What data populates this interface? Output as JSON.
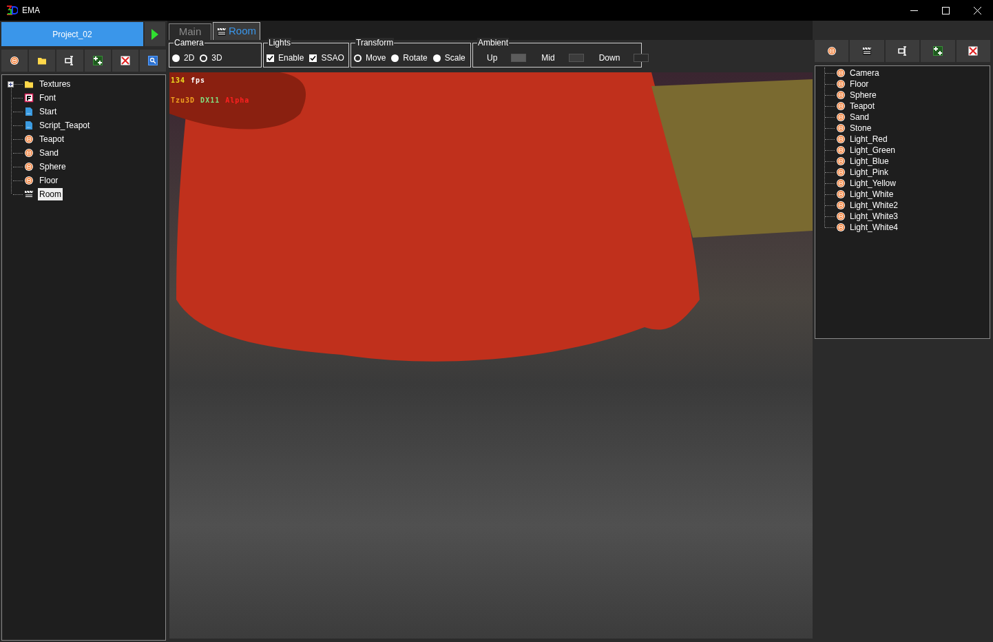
{
  "window": {
    "title": "EMA"
  },
  "project": {
    "name": "Project_02"
  },
  "scene_tree": [
    {
      "label": "Textures",
      "kind": "folder",
      "expanded": false,
      "selected": false
    },
    {
      "label": "Font",
      "kind": "font",
      "selected": false
    },
    {
      "label": "Start",
      "kind": "script",
      "selected": false
    },
    {
      "label": "Script_Teapot",
      "kind": "script",
      "selected": false
    },
    {
      "label": "Teapot",
      "kind": "object",
      "selected": false
    },
    {
      "label": "Sand",
      "kind": "object",
      "selected": false
    },
    {
      "label": "Sphere",
      "kind": "object",
      "selected": false
    },
    {
      "label": "Floor",
      "kind": "object",
      "selected": false
    },
    {
      "label": "Room",
      "kind": "scene",
      "selected": true
    }
  ],
  "tabs": [
    {
      "label": "Main",
      "kind": "plain",
      "selected": false
    },
    {
      "label": "Room",
      "kind": "scene",
      "selected": true
    }
  ],
  "camera": {
    "title": "Camera",
    "options": [
      {
        "label": "2D",
        "selected": false
      },
      {
        "label": "3D",
        "selected": true
      }
    ]
  },
  "lights": {
    "title": "Lights",
    "options": [
      {
        "label": "Enable",
        "checked": true
      },
      {
        "label": "SSAO",
        "checked": true
      }
    ]
  },
  "transform": {
    "title": "Transform",
    "options": [
      {
        "label": "Move",
        "selected": true
      },
      {
        "label": "Rotate",
        "selected": false
      },
      {
        "label": "Scale",
        "selected": false
      }
    ]
  },
  "ambient": {
    "title": "Ambient",
    "swatches": [
      {
        "label": "Up",
        "color": "#5c5c5c"
      },
      {
        "label": "Mid",
        "color": "#3c3c3c"
      },
      {
        "label": "Down",
        "color": "#2a2a2a"
      }
    ]
  },
  "overlay": {
    "lines": [
      [
        {
          "text": "134",
          "color": "#f0e020"
        },
        {
          "text": "fps",
          "color": "#ffffff"
        }
      ],
      [
        {
          "text": "Tzu3D",
          "color": "#f0a020"
        },
        {
          "text": "DX11",
          "color": "#80e080"
        },
        {
          "text": "Alpha",
          "color": "#ff2020"
        }
      ]
    ]
  },
  "room_objects": [
    "Camera",
    "Floor",
    "Sphere",
    "Teapot",
    "Sand",
    "Stone",
    "Light_Red",
    "Light_Green",
    "Light_Blue",
    "Light_Pink",
    "Light_Yellow",
    "Light_White",
    "Light_White2",
    "Light_White3",
    "Light_White4"
  ]
}
